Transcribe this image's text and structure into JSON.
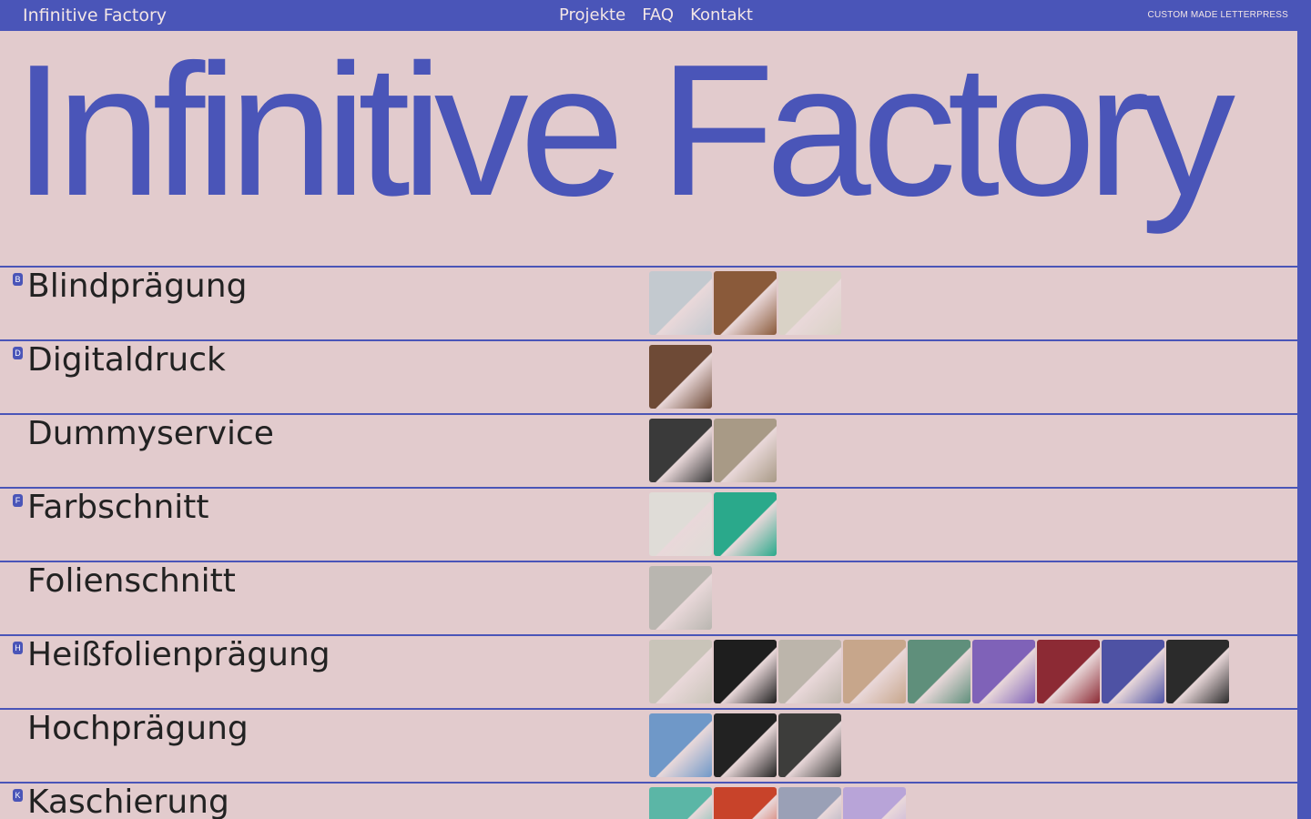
{
  "header": {
    "brand": "Infinitive Factory",
    "nav": [
      "Projekte",
      "FAQ",
      "Kontakt"
    ],
    "tagline": "CUSTOM MADE LETTERPRESS"
  },
  "hero": {
    "title": "Infinitive Factory"
  },
  "categories": [
    {
      "label": "Blindprägung",
      "badge": "B",
      "thumbs": [
        "#c3c9cf",
        "#8a5a3a",
        "#d9d2c6"
      ]
    },
    {
      "label": "Digitaldruck",
      "badge": "D",
      "thumbs": [
        "#6e4a36"
      ]
    },
    {
      "label": "Dummyservice",
      "badge": "",
      "thumbs": [
        "#3a3a3a",
        "#a89a86"
      ]
    },
    {
      "label": "Farbschnitt",
      "badge": "F",
      "thumbs": [
        "#dfdcd7",
        "#2aa98b"
      ]
    },
    {
      "label": "Folienschnitt",
      "badge": "",
      "thumbs": [
        "#b9b6b0"
      ]
    },
    {
      "label": "Heißfolienprägung",
      "badge": "H",
      "thumbs": [
        "#c9c4b9",
        "#1e1e1e",
        "#bcb5ab",
        "#c7a68b",
        "#5f8f7b",
        "#7f62b8",
        "#8c2a34",
        "#4e52a4",
        "#2b2b2b"
      ]
    },
    {
      "label": "Hochprägung",
      "badge": "",
      "thumbs": [
        "#6f98c8",
        "#222222",
        "#3d3d3b"
      ]
    },
    {
      "label": "Kaschierung",
      "badge": "K",
      "thumbs": [
        "#5bb6a6",
        "#c8432a",
        "#9aa0b6",
        "#b8a4d8"
      ]
    }
  ],
  "colors": {
    "accent": "#4a55b8",
    "background": "#e2cbcd",
    "text": "#222222"
  }
}
